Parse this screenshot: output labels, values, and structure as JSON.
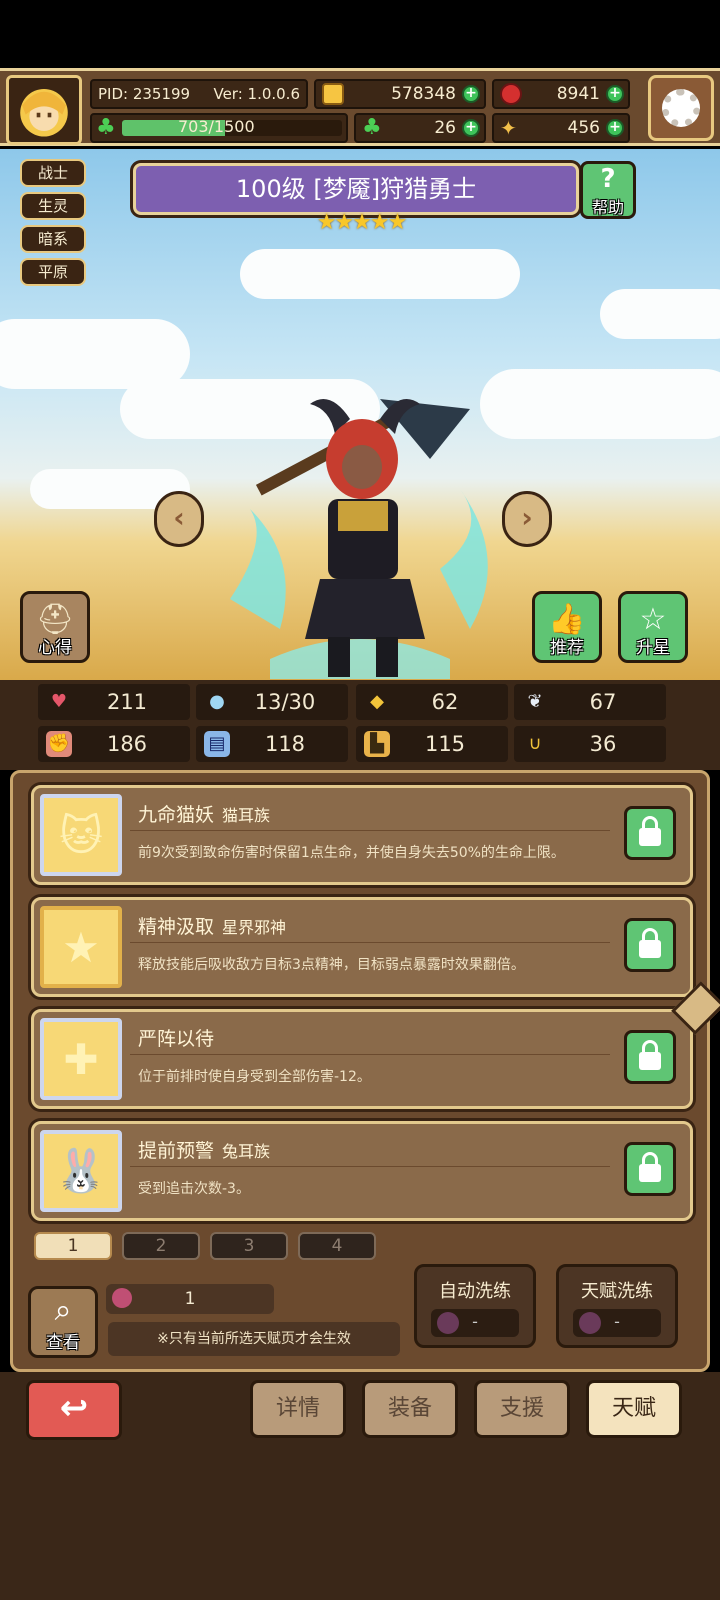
{
  "header": {
    "pid": "PID: 235199",
    "version": "Ver: 1.0.0.6",
    "gold": "578348",
    "gems": "8941",
    "xp": "703/1500",
    "xp_progress": 0.469,
    "clover": "26",
    "bone": "456"
  },
  "hero": {
    "tags": [
      "战士",
      "生灵",
      "暗系",
      "平原"
    ],
    "title": "100级 [梦魇]狩猎勇士",
    "stars": 5,
    "help_label": "帮助",
    "left_button": "心得",
    "recommend_button": "推荐",
    "upgrade_button": "升星"
  },
  "stats": [
    {
      "icon": "heart-icon",
      "value": "211"
    },
    {
      "icon": "mana-drop-icon",
      "value": "13/30"
    },
    {
      "icon": "shield-icon",
      "value": "62"
    },
    {
      "icon": "wing-icon",
      "value": "67"
    },
    {
      "icon": "fist-icon",
      "value": "186"
    },
    {
      "icon": "book-icon",
      "value": "118"
    },
    {
      "icon": "boot-icon",
      "value": "115"
    },
    {
      "icon": "horseshoe-icon",
      "value": "36"
    }
  ],
  "talents": [
    {
      "name": "九命猫妖",
      "sub": "猫耳族",
      "desc": "前9次受到致命伤害时保留1点生命，并使自身失去50%的生命上限。",
      "icon": "cat-icon"
    },
    {
      "name": "精神汲取",
      "sub": "星界邪神",
      "desc": "释放技能后吸收敌方目标3点精神，目标弱点暴露时效果翻倍。",
      "icon": "star-icon"
    },
    {
      "name": "严阵以待",
      "sub": "",
      "desc": "位于前排时使自身受到全部伤害-12。",
      "icon": "cross-icon"
    },
    {
      "name": "提前预警",
      "sub": "兔耳族",
      "desc": "受到追击次数-3。",
      "icon": "rabbit-icon"
    }
  ],
  "pages": [
    "1",
    "2",
    "3",
    "4"
  ],
  "footer": {
    "search_label": "查看",
    "fruit_count": "1",
    "note": "※只有当前所选天赋页才会生效",
    "auto_wash": "自动洗练",
    "auto_wash_value": "-",
    "talent_wash": "天赋洗练",
    "talent_wash_value": "-"
  },
  "nav": {
    "back": "↩",
    "tabs": [
      "详情",
      "装备",
      "支援",
      "天赋"
    ],
    "active": "天赋"
  }
}
